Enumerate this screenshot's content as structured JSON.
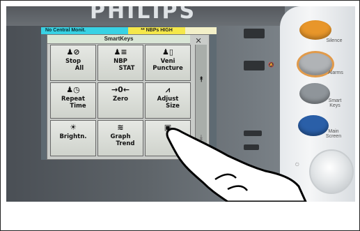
{
  "brand": "PHILIPS",
  "status": {
    "left": "No Central Monit.",
    "mid": "** NBPs  HIGH"
  },
  "dialog": {
    "title": "SmartKeys",
    "close_glyph": "×",
    "keys": [
      {
        "line1": "Stop",
        "line2": "All",
        "icon": "stop-all-icon",
        "glyph": "♟⊘"
      },
      {
        "line1": "NBP",
        "line2": "STAT",
        "icon": "nbp-stat-icon",
        "glyph": "♟≡"
      },
      {
        "line1": "Veni",
        "line2": "Puncture",
        "icon": "veni-puncture-icon",
        "glyph": "♟▯"
      },
      {
        "line1": "Repeat",
        "line2": "Time",
        "icon": "repeat-time-icon",
        "glyph": "♟◷"
      },
      {
        "line1": "Zero",
        "line2": "",
        "icon": "zero-icon",
        "glyph": "→0←"
      },
      {
        "line1": "Adjust",
        "line2": "Size",
        "icon": "adjust-size-icon",
        "glyph": "⩘"
      },
      {
        "line1": "Brightn.",
        "line2": "",
        "icon": "brightness-icon",
        "glyph": "☀"
      },
      {
        "line1": "Graph",
        "line2": "Trend",
        "icon": "graph-trend-icon",
        "glyph": "≋"
      },
      {
        "line1": "",
        "line2": "",
        "icon": "main-screen-key-icon",
        "glyph": "▣"
      }
    ],
    "scroll_up": "⯭",
    "scroll_down": "⯯"
  },
  "hardware": {
    "silence": "Silence",
    "alarms": "Alarms",
    "smart_keys": "Smart Keys",
    "main_screen": "Main Screen",
    "colors": {
      "silence": "#e8962a",
      "alarms": "#b0b3b6",
      "smart": "#8f959a",
      "main": "#2a5fa8"
    }
  }
}
